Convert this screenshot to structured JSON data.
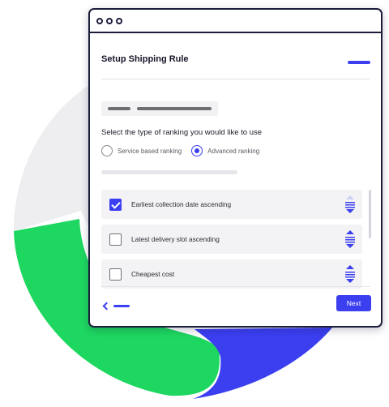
{
  "colors": {
    "accent": "#3b3ff0",
    "brand_green": "#1ed760",
    "ring_grey": "#eeeef0",
    "frame": "#1c1d3a"
  },
  "dialog": {
    "title": "Setup Shipping Rule",
    "question": "Select the type of ranking you would like to use",
    "ranking_options": [
      {
        "label": "Service based ranking",
        "selected": false
      },
      {
        "label": "Advanced ranking",
        "selected": true
      }
    ],
    "rules": [
      {
        "label": "Earliest collection date ascending",
        "checked": true,
        "icon": "reorder-arrows-icon"
      },
      {
        "label": "Latest delivery slot ascending",
        "checked": false,
        "icon": "reorder-arrows-icon"
      },
      {
        "label": "Cheapest cost",
        "checked": false,
        "icon": "reorder-arrows-icon"
      }
    ],
    "back_icon": "chevron-left-icon",
    "next_label": "Next"
  }
}
